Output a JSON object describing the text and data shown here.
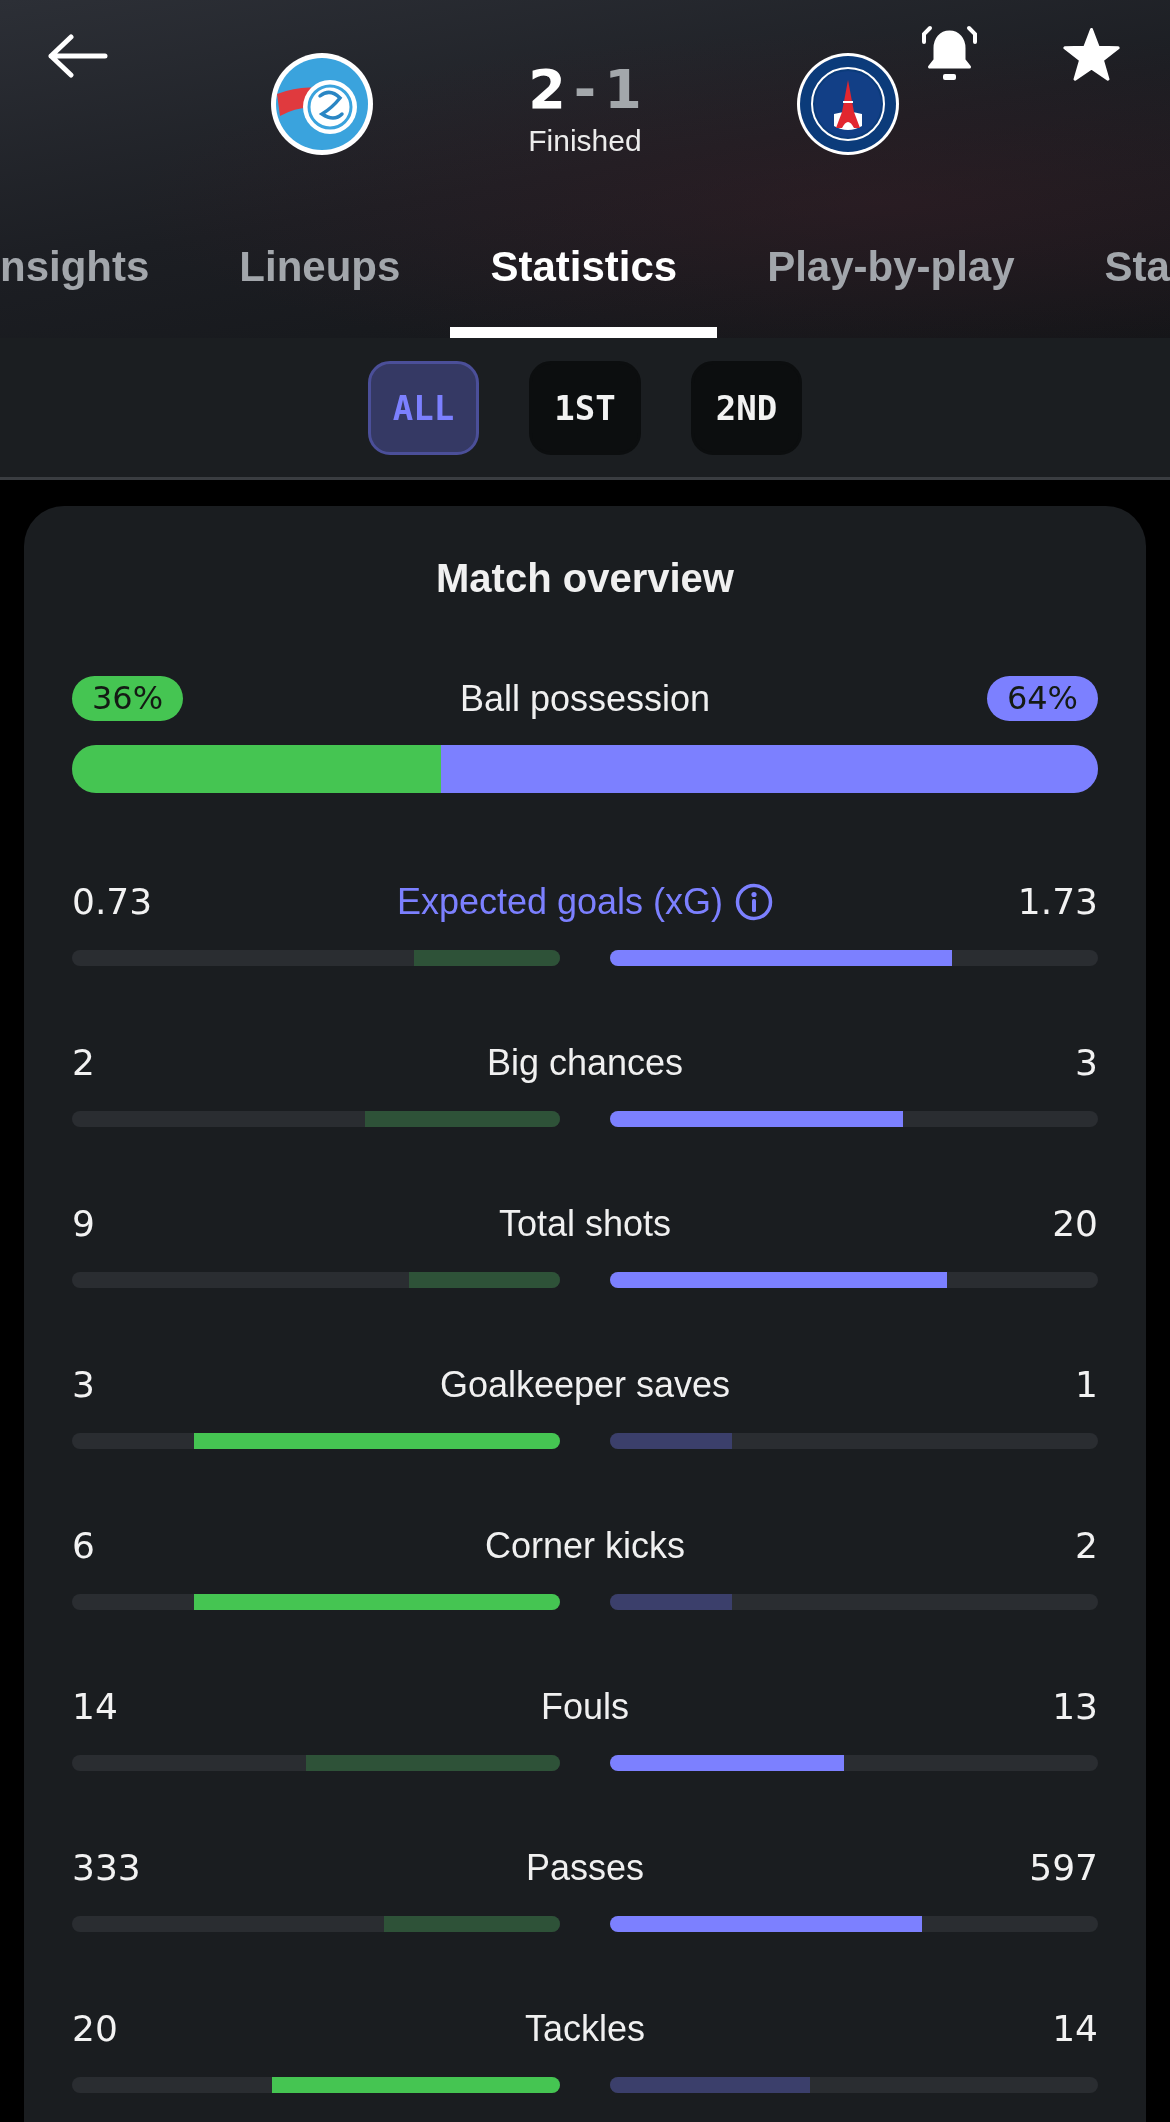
{
  "toolbar": {
    "notifications_on": true,
    "favorite": true
  },
  "match": {
    "home": {
      "score": "2",
      "leading": true
    },
    "separator": "-",
    "away": {
      "score": "1",
      "leading": false
    },
    "status": "Finished"
  },
  "tabs": [
    {
      "label": "nsights",
      "selected": false
    },
    {
      "label": "Lineups",
      "selected": false
    },
    {
      "label": "Statistics",
      "selected": true
    },
    {
      "label": "Play-by-play",
      "selected": false
    },
    {
      "label": "Sta",
      "selected": false
    }
  ],
  "periods": [
    {
      "label": "ALL",
      "selected": true
    },
    {
      "label": "1ST",
      "selected": false
    },
    {
      "label": "2ND",
      "selected": false
    }
  ],
  "overview": {
    "title": "Match overview",
    "possession": {
      "label": "Ball possession",
      "home": {
        "value": "36%",
        "level": 0.36
      },
      "away": {
        "value": "64%",
        "level": 0.64
      }
    },
    "stats": [
      {
        "kind": "info",
        "label": "Expected goals (xG)",
        "home": {
          "value": "0.73",
          "level": 0.3,
          "leading": false
        },
        "away": {
          "value": "1.73",
          "level": 0.7,
          "leading": true
        }
      },
      {
        "kind": "plain",
        "label": "Big chances",
        "home": {
          "value": "2",
          "level": 0.4,
          "leading": false
        },
        "away": {
          "value": "3",
          "level": 0.6,
          "leading": true
        }
      },
      {
        "kind": "plain",
        "label": "Total shots",
        "home": {
          "value": "9",
          "level": 0.31,
          "leading": false
        },
        "away": {
          "value": "20",
          "level": 0.69,
          "leading": true
        }
      },
      {
        "kind": "plain",
        "label": "Goalkeeper saves",
        "home": {
          "value": "3",
          "level": 0.75,
          "leading": true
        },
        "away": {
          "value": "1",
          "level": 0.25,
          "leading": false
        }
      },
      {
        "kind": "plain",
        "label": "Corner kicks",
        "home": {
          "value": "6",
          "level": 0.75,
          "leading": true
        },
        "away": {
          "value": "2",
          "level": 0.25,
          "leading": false
        }
      },
      {
        "kind": "plain",
        "label": "Fouls",
        "home": {
          "value": "14",
          "level": 0.52,
          "leading": false
        },
        "away": {
          "value": "13",
          "level": 0.48,
          "leading": true
        }
      },
      {
        "kind": "plain",
        "label": "Passes",
        "home": {
          "value": "333",
          "level": 0.36,
          "leading": false
        },
        "away": {
          "value": "597",
          "level": 0.64,
          "leading": true
        }
      },
      {
        "kind": "plain",
        "label": "Tackles",
        "home": {
          "value": "20",
          "level": 0.59,
          "leading": true
        },
        "away": {
          "value": "14",
          "level": 0.41,
          "leading": false
        }
      }
    ]
  }
}
